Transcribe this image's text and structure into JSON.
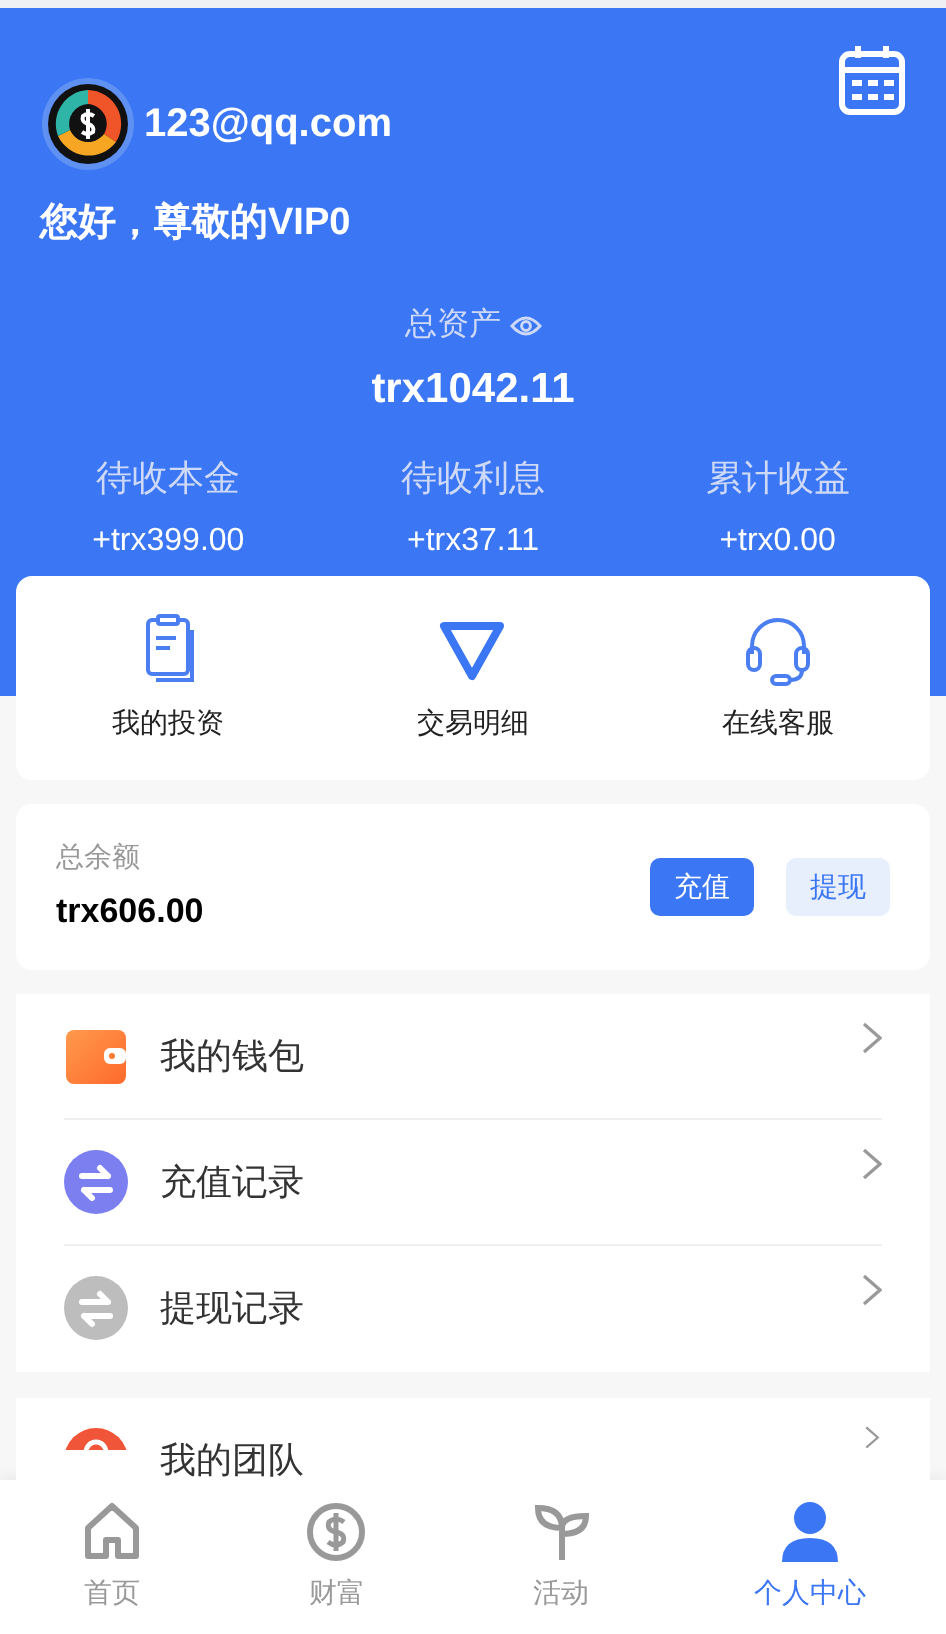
{
  "user": {
    "email": "123@qq.com",
    "greeting": "您好，尊敬的VIP0"
  },
  "assets": {
    "label": "总资产",
    "value": "trx1042.11"
  },
  "stats": [
    {
      "label": "待收本金",
      "value": "+trx399.00"
    },
    {
      "label": "待收利息",
      "value": "+trx37.11"
    },
    {
      "label": "累计收益",
      "value": "+trx0.00"
    }
  ],
  "shortcuts": [
    {
      "label": "我的投资"
    },
    {
      "label": "交易明细"
    },
    {
      "label": "在线客服"
    }
  ],
  "balance": {
    "label": "总余额",
    "value": "trx606.00",
    "buttons": [
      {
        "label": "充值",
        "kind": "primary"
      },
      {
        "label": "提现",
        "kind": "secondary"
      }
    ]
  },
  "menu_groups": [
    [
      {
        "label": "我的钱包"
      },
      {
        "label": "充值记录"
      },
      {
        "label": "提现记录"
      }
    ],
    [
      {
        "label": "我的团队"
      }
    ]
  ],
  "tabs": [
    {
      "label": "首页",
      "selected": false
    },
    {
      "label": "财富",
      "selected": false
    },
    {
      "label": "活动",
      "selected": false
    },
    {
      "label": "个人中心",
      "selected": true
    }
  ]
}
